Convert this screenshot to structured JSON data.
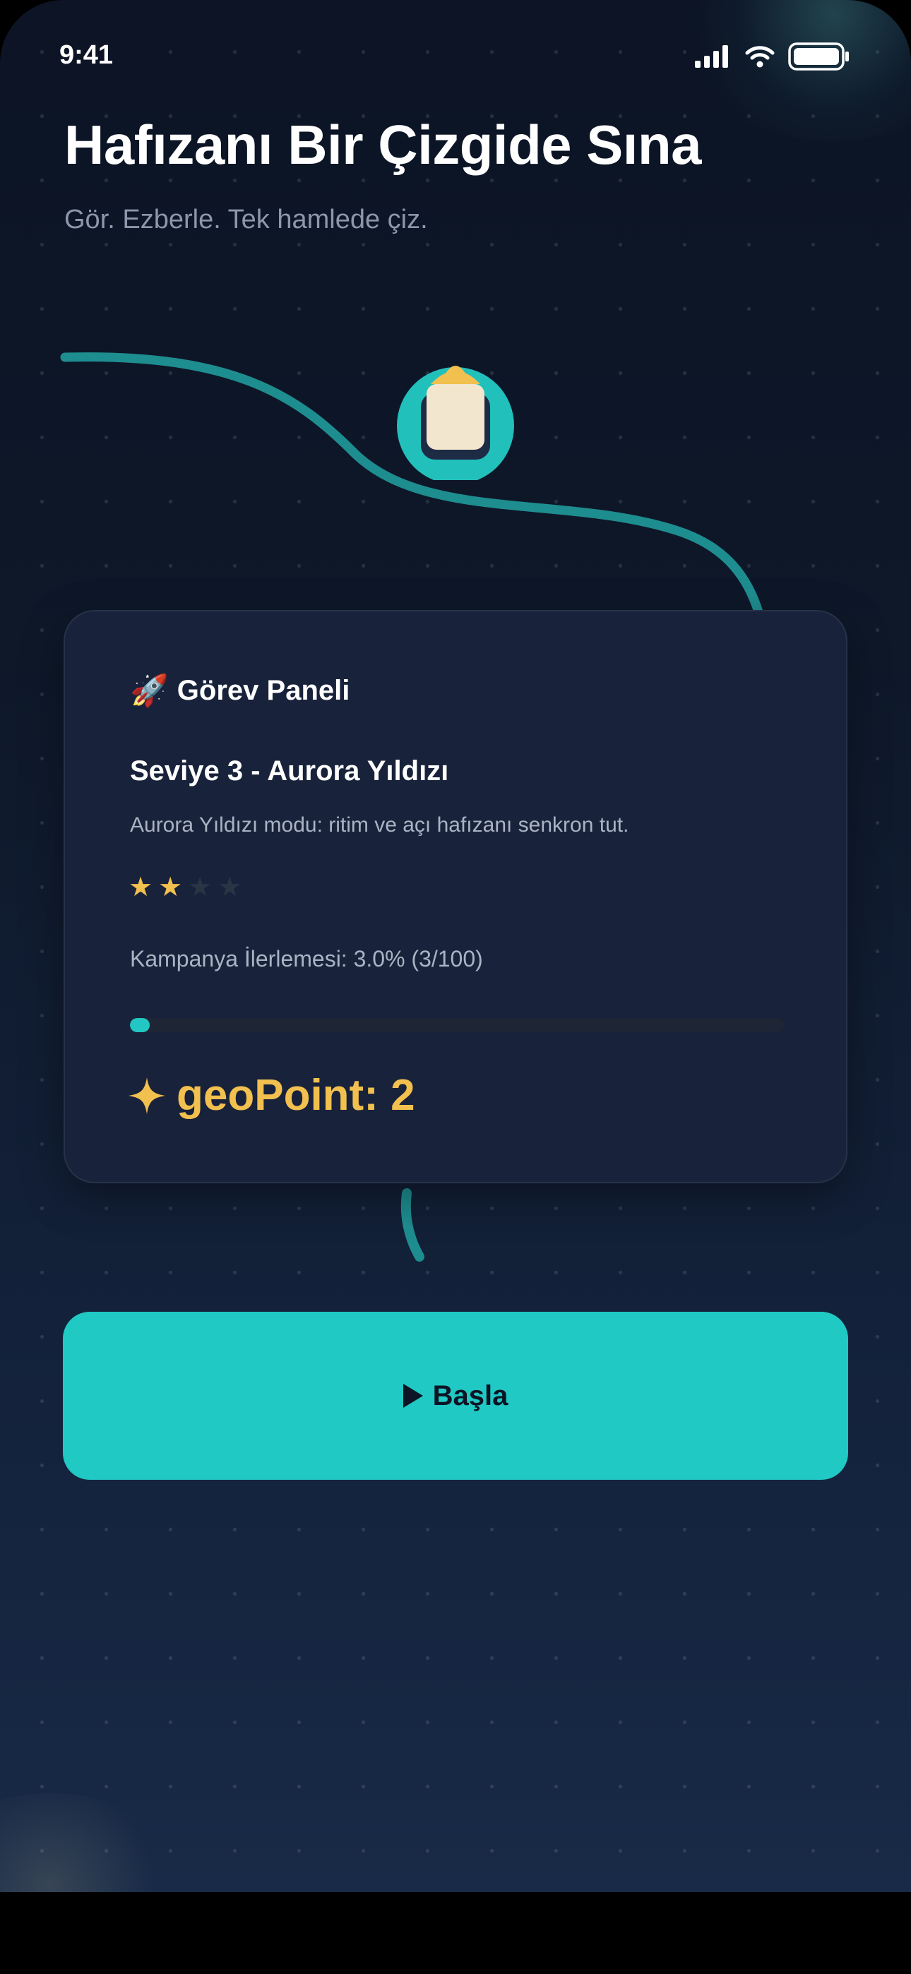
{
  "status_bar": {
    "time": "9:41"
  },
  "header": {
    "title": "Hafızanı Bir Çizgide Sına",
    "subtitle": "Gör. Ezberle. Tek hamlede çiz."
  },
  "panel": {
    "icon": "rocket-icon",
    "heading": "Görev Paneli",
    "level_title": "Seviye 3 - Aurora Yıldızı",
    "level_description": "Aurora Yıldızı modu: ritim ve açı hafızanı senkron tut.",
    "stars_total": 4,
    "stars_filled": 2,
    "progress_label": "Kampanya İlerlemesi: 3.0% (3/100)",
    "progress_fraction": 0.03,
    "points_icon": "sparkle-icon",
    "points_text": "geoPoint: 2"
  },
  "start_button": {
    "label": "Başla",
    "icon": "play-icon"
  },
  "colors": {
    "background": "#0e1829",
    "accent": "#20c9c4",
    "card": "#18223a",
    "star_filled": "#f2c04e",
    "star_empty": "#293445",
    "points": "#f2c04e",
    "marker_ring": "#22c0bb",
    "marker_body": "#f2e6cf",
    "marker_tip": "#f2c04e"
  }
}
